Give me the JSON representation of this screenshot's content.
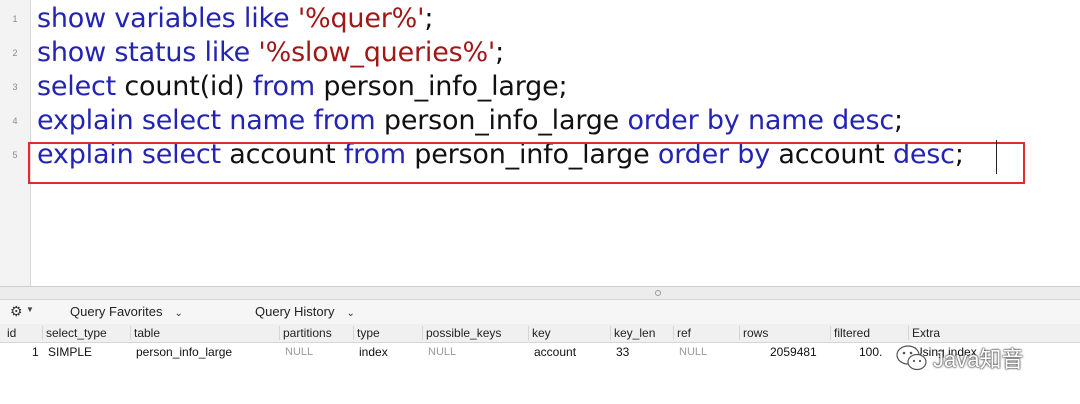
{
  "editor": {
    "line_numbers": [
      "1",
      "2",
      "3",
      "4",
      "5"
    ],
    "lines": [
      {
        "t1": "show variables like ",
        "t2": "'%quer%'",
        "t3": ";"
      },
      {
        "t1": "show status like ",
        "t2": "'%slow_queries%'",
        "t3": ";"
      },
      {
        "t1": "select",
        "t2": " count(id) ",
        "t3": "from",
        "t4": " person_info_large;"
      },
      {
        "t1": "explain select name from",
        "t2": " person_info_large ",
        "t3": "order by name desc",
        "t4": ";"
      },
      {
        "t1": "explain select",
        "t2": " account ",
        "t3": "from",
        "t4": " person_info_large ",
        "t5": "order by",
        "t6": " account ",
        "t7": "desc",
        "t8": ";"
      }
    ]
  },
  "toolbar": {
    "query_favorites": "Query Favorites",
    "query_history": "Query History",
    "chevron": "⌄"
  },
  "results": {
    "columns": [
      "id",
      "select_type",
      "table",
      "partitions",
      "type",
      "possible_keys",
      "key",
      "key_len",
      "ref",
      "rows",
      "filtered",
      "Extra"
    ],
    "row": {
      "id": "1",
      "select_type": "SIMPLE",
      "table": "person_info_large",
      "partitions": "NULL",
      "type": "index",
      "possible_keys": "NULL",
      "key": "account",
      "key_len": "33",
      "ref": "NULL",
      "rows": "2059481",
      "filtered": "100.",
      "extra": "Using index"
    }
  },
  "watermark": {
    "text": "Java知音"
  },
  "colors": {
    "keyword": "#2323b4",
    "string": "#a01818",
    "highlight_box": "#e22b2b"
  }
}
